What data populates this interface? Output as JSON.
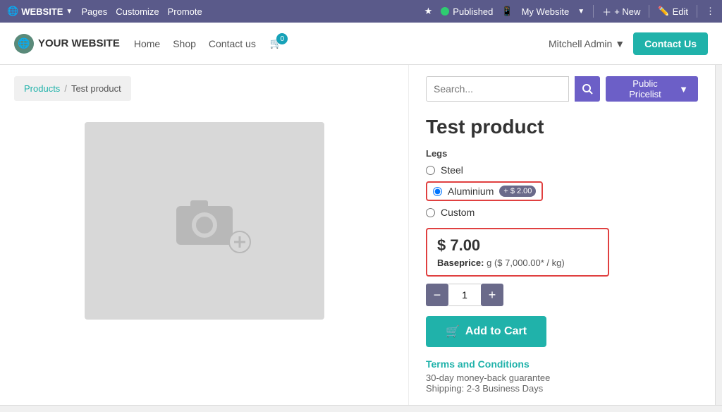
{
  "adminBar": {
    "websiteLabel": "WEBSITE",
    "pages": "Pages",
    "customize": "Customize",
    "promote": "Promote",
    "published": "Published",
    "myWebsite": "My Website",
    "new": "+ New",
    "edit": "Edit"
  },
  "websiteNav": {
    "logoText": "YOUR WEBSITE",
    "home": "Home",
    "shop": "Shop",
    "contactUs": "Contact us",
    "cartCount": "0",
    "adminUser": "Mitchell Admin",
    "contactBtn": "Contact Us"
  },
  "breadcrumb": {
    "products": "Products",
    "separator": "/",
    "current": "Test product"
  },
  "search": {
    "placeholder": "Search...",
    "pricelistLabel": "Public Pricelist"
  },
  "product": {
    "title": "Test product",
    "attributeLabel": "Legs",
    "options": [
      {
        "label": "Steel",
        "selected": false,
        "badge": null
      },
      {
        "label": "Aluminium",
        "selected": true,
        "badge": "+ $ 2.00"
      },
      {
        "label": "Custom",
        "selected": false,
        "badge": null
      }
    ],
    "price": "$ 7.00",
    "baseprice": "Baseprice:",
    "baseprice_value": "g ($ 7,000.00* / kg)",
    "quantity": "1",
    "addToCartLabel": "Add to Cart",
    "termsTitle": "Terms and Conditions",
    "termsLine1": "30-day money-back guarantee",
    "termsLine2": "Shipping: 2-3 Business Days"
  }
}
